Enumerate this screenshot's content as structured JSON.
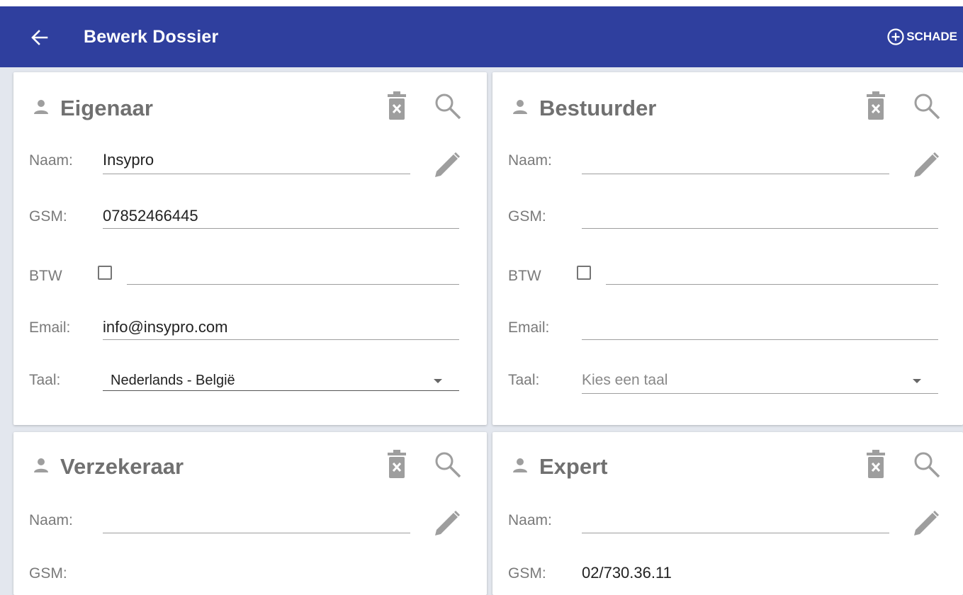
{
  "appbar": {
    "title": "Bewerk Dossier",
    "action_label": "SCHADE",
    "color": "#2f3f9e"
  },
  "cards": {
    "eigenaar": {
      "title": "Eigenaar",
      "naam_label": "Naam:",
      "naam_value": "Insypro",
      "gsm_label": "GSM:",
      "gsm_value": "07852466445",
      "btw_label": "BTW",
      "email_label": "Email:",
      "email_value": "info@insypro.com",
      "taal_label": "Taal:",
      "taal_value": "Nederlands - België"
    },
    "bestuurder": {
      "title": "Bestuurder",
      "naam_label": "Naam:",
      "gsm_label": "GSM:",
      "btw_label": "BTW",
      "email_label": "Email:",
      "taal_label": "Taal:",
      "taal_placeholder": "Kies een taal"
    },
    "verzekeraar": {
      "title": "Verzekeraar",
      "naam_label": "Naam:",
      "gsm_label": "GSM:"
    },
    "expert": {
      "title": "Expert",
      "naam_label": "Naam:",
      "gsm_label": "GSM:",
      "gsm_value": "02/730.36.11"
    }
  },
  "icons": {
    "header": "person-icon",
    "delete": "trash-icon",
    "search": "search-icon",
    "edit": "pencil-icon",
    "back": "arrow-back-icon",
    "add": "add-circle-icon"
  }
}
